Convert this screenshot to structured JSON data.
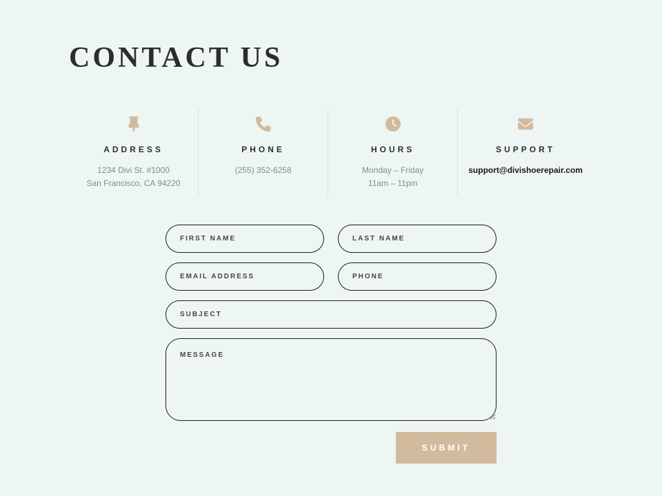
{
  "heading": "CONTACT US",
  "info": {
    "address": {
      "title": "ADDRESS",
      "line1": "1234 Divi St. #1000",
      "line2": "San Francisco, CA 94220"
    },
    "phone": {
      "title": "PHONE",
      "value": "(255) 352-6258"
    },
    "hours": {
      "title": "HOURS",
      "line1": "Monday – Friday",
      "line2": "11am – 11pm"
    },
    "support": {
      "title": "SUPPORT",
      "email": "support@divishoerepair.com"
    }
  },
  "form": {
    "first_name_placeholder": "FIRST NAME",
    "last_name_placeholder": "LAST NAME",
    "email_placeholder": "EMAIL ADDRESS",
    "phone_placeholder": "PHONE",
    "subject_placeholder": "SUBJECT",
    "message_placeholder": "MESSAGE",
    "submit_label": "SUBMIT"
  },
  "colors": {
    "accent": "#d2bb9d",
    "bg": "#eef6f4",
    "text_dark": "#2b2e30",
    "text_muted": "#848a8c"
  }
}
